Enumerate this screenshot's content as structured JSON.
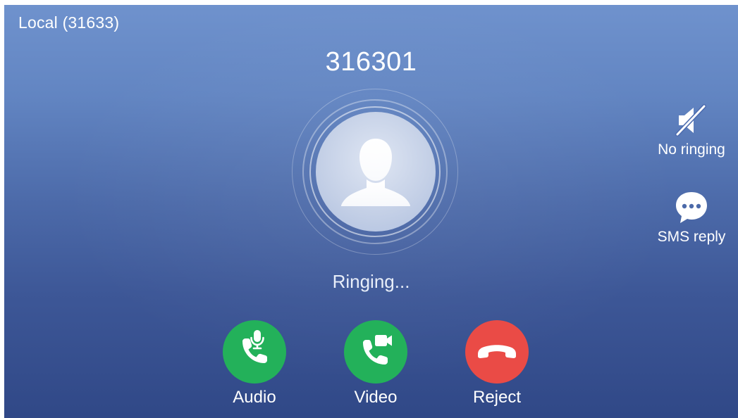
{
  "header": {
    "account": "Local (31633)"
  },
  "call": {
    "number": "316301",
    "status": "Ringing..."
  },
  "side_actions": {
    "no_ringing": {
      "label": "No ringing",
      "icon": "speaker-muted-icon"
    },
    "sms_reply": {
      "label": "SMS reply",
      "icon": "chat-bubble-icon"
    }
  },
  "buttons": {
    "audio": {
      "label": "Audio",
      "icon": "phone-mic-icon",
      "color": "#23b15a"
    },
    "video": {
      "label": "Video",
      "icon": "phone-video-icon",
      "color": "#23b15a"
    },
    "reject": {
      "label": "Reject",
      "icon": "hang-up-icon",
      "color": "#ea4b46"
    }
  },
  "avatar": {
    "icon": "default-person-icon"
  }
}
